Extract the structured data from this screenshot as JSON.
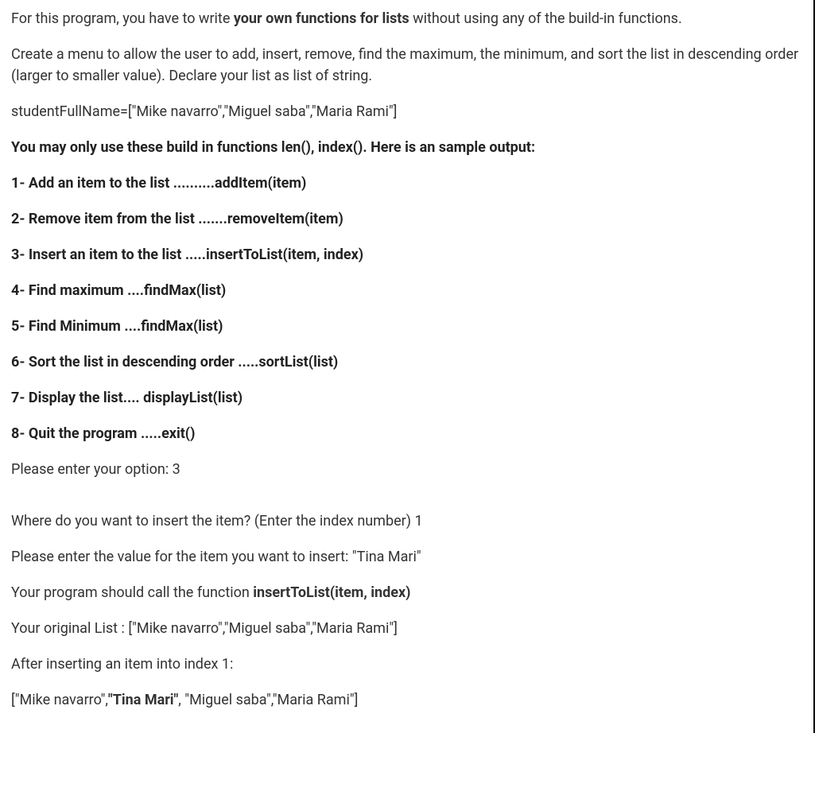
{
  "intro": {
    "line1_pre": "For this program, you have to write ",
    "line1_bold": "your own functions for lists",
    "line1_post": " without using any of the build-in functions.",
    "line2": "Create a menu to allow the user to add, insert, remove, find the maximum, the minimum, and sort the list in descending order (larger to smaller value). Declare your list as list of string.",
    "line3": "studentFullName=[\"Mike navarro\",\"Miguel saba\",\"Maria Rami\"]"
  },
  "instructions_header": "You may only use these build in functions len(), index(). Here is an sample output:",
  "menu": {
    "item1": "1- Add an item to the list  ..........addItem(item)",
    "item2": "2- Remove item from the list .......removeItem(item)",
    "item3": "3- Insert an item to the list .....insertToList(item, index)",
    "item4": "4- Find maximum ....findMax(list)",
    "item5": "5- Find Minimum ....findMax(list)",
    "item6": "6- Sort the list in descending order .....sortList(list)",
    "item7": "7- Display the list.... displayList(list)",
    "item8": "8- Quit the program .....exit()"
  },
  "prompt_option": "Please enter your option: 3",
  "interaction": {
    "where_insert": "Where do you want to insert the item? (Enter the index number) 1",
    "enter_value": "Please enter the value for the item you want to insert: \"Tina Mari\"",
    "call_fn_pre": "Your program should call the function  ",
    "call_fn_bold": "insertToList(item, index)",
    "original_list": "Your original List : [\"Mike navarro\",\"Miguel saba\",\"Maria Rami\"]",
    "after_insert": "After inserting an item into index 1:",
    "result_pre": "[\"Mike navarro\",",
    "result_bold": "\"Tina Mari\"",
    "result_post": ", \"Miguel saba\",\"Maria Rami\"]"
  }
}
